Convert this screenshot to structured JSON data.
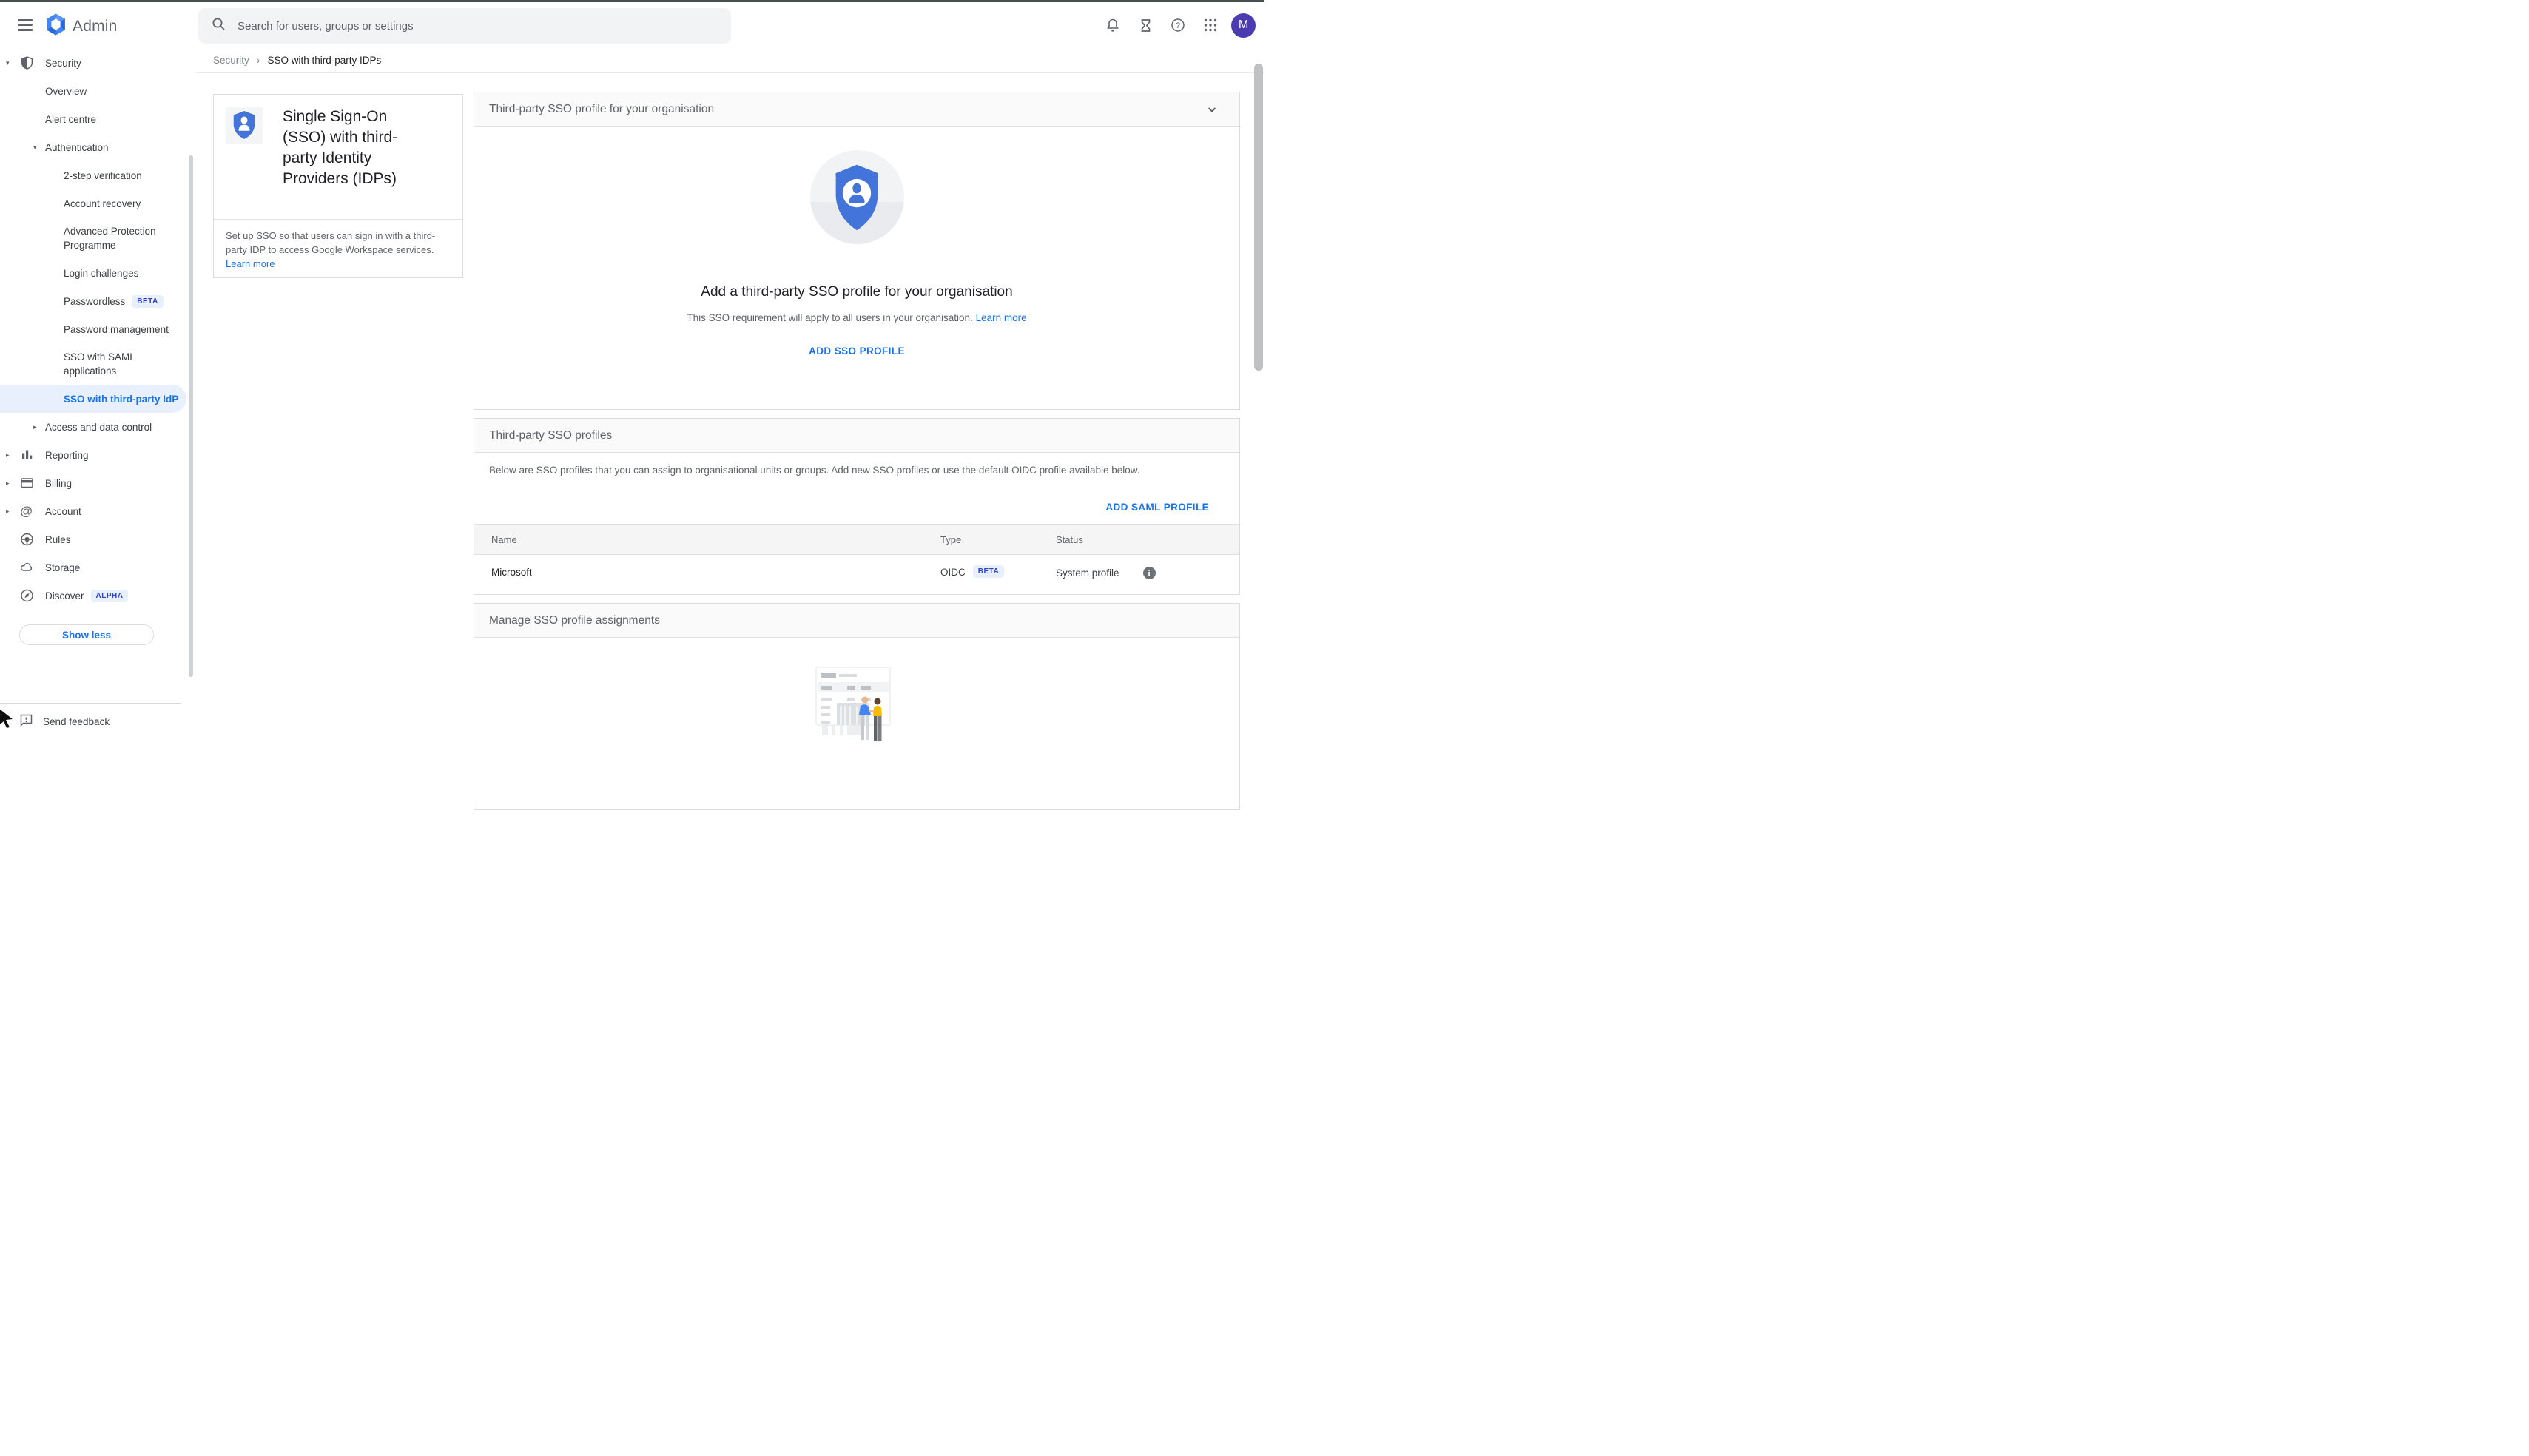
{
  "header": {
    "product_name": "Admin",
    "search_placeholder": "Search for users, groups or settings",
    "avatar_initial": "M"
  },
  "breadcrumb": {
    "parent": "Security",
    "separator": "›",
    "current": "SSO with third-party IDPs"
  },
  "sidebar": {
    "items": [
      {
        "label": "Security"
      },
      {
        "label": "Overview"
      },
      {
        "label": "Alert centre"
      },
      {
        "label": "Authentication"
      },
      {
        "label": "2-step verification"
      },
      {
        "label": "Account recovery"
      },
      {
        "label": "Advanced Protection Programme"
      },
      {
        "label": "Login challenges"
      },
      {
        "label": "Passwordless",
        "badge": "BETA"
      },
      {
        "label": "Password management"
      },
      {
        "label": "SSO with SAML applications"
      },
      {
        "label": "SSO with third-party IdP",
        "selected": true
      },
      {
        "label": "Access and data control"
      },
      {
        "label": "Reporting"
      },
      {
        "label": "Billing"
      },
      {
        "label": "Account"
      },
      {
        "label": "Rules"
      },
      {
        "label": "Storage"
      },
      {
        "label": "Discover",
        "badge": "ALPHA"
      }
    ],
    "show_less_label": "Show less",
    "send_feedback_label": "Send feedback"
  },
  "info_card": {
    "title": "Single Sign-On (SSO) with third-party Identity Providers (IDPs)",
    "description": "Set up SSO so that users can sign in with a third-party IDP to access Google Workspace services.",
    "learn_more": "Learn more"
  },
  "panel_sso_org": {
    "header": "Third-party SSO profile for your organisation",
    "heading": "Add a third-party SSO profile for your organisation",
    "subtext": "This SSO requirement will apply to all users in your organisation.",
    "learn_more": "Learn more",
    "add_button": "ADD SSO PROFILE"
  },
  "panel_profiles": {
    "header": "Third-party SSO profiles",
    "description": "Below are SSO profiles that you can assign to organisational units or groups. Add new SSO profiles or use the default OIDC profile available below.",
    "add_saml_button": "ADD SAML PROFILE",
    "table": {
      "columns": {
        "name": "Name",
        "type": "Type",
        "status": "Status"
      },
      "row": {
        "name": "Microsoft",
        "type": "OIDC",
        "type_badge": "BETA",
        "status": "System profile"
      }
    }
  },
  "panel_assignments": {
    "header": "Manage SSO profile assignments"
  },
  "colors": {
    "accent_blue": "#1a73e8",
    "selected_bg": "#e8f0fe",
    "shield_blue": "#4374d9",
    "avatar_purple": "#4a3cb0",
    "person_blue": "#4285f4",
    "person_yellow": "#fbbc04"
  }
}
